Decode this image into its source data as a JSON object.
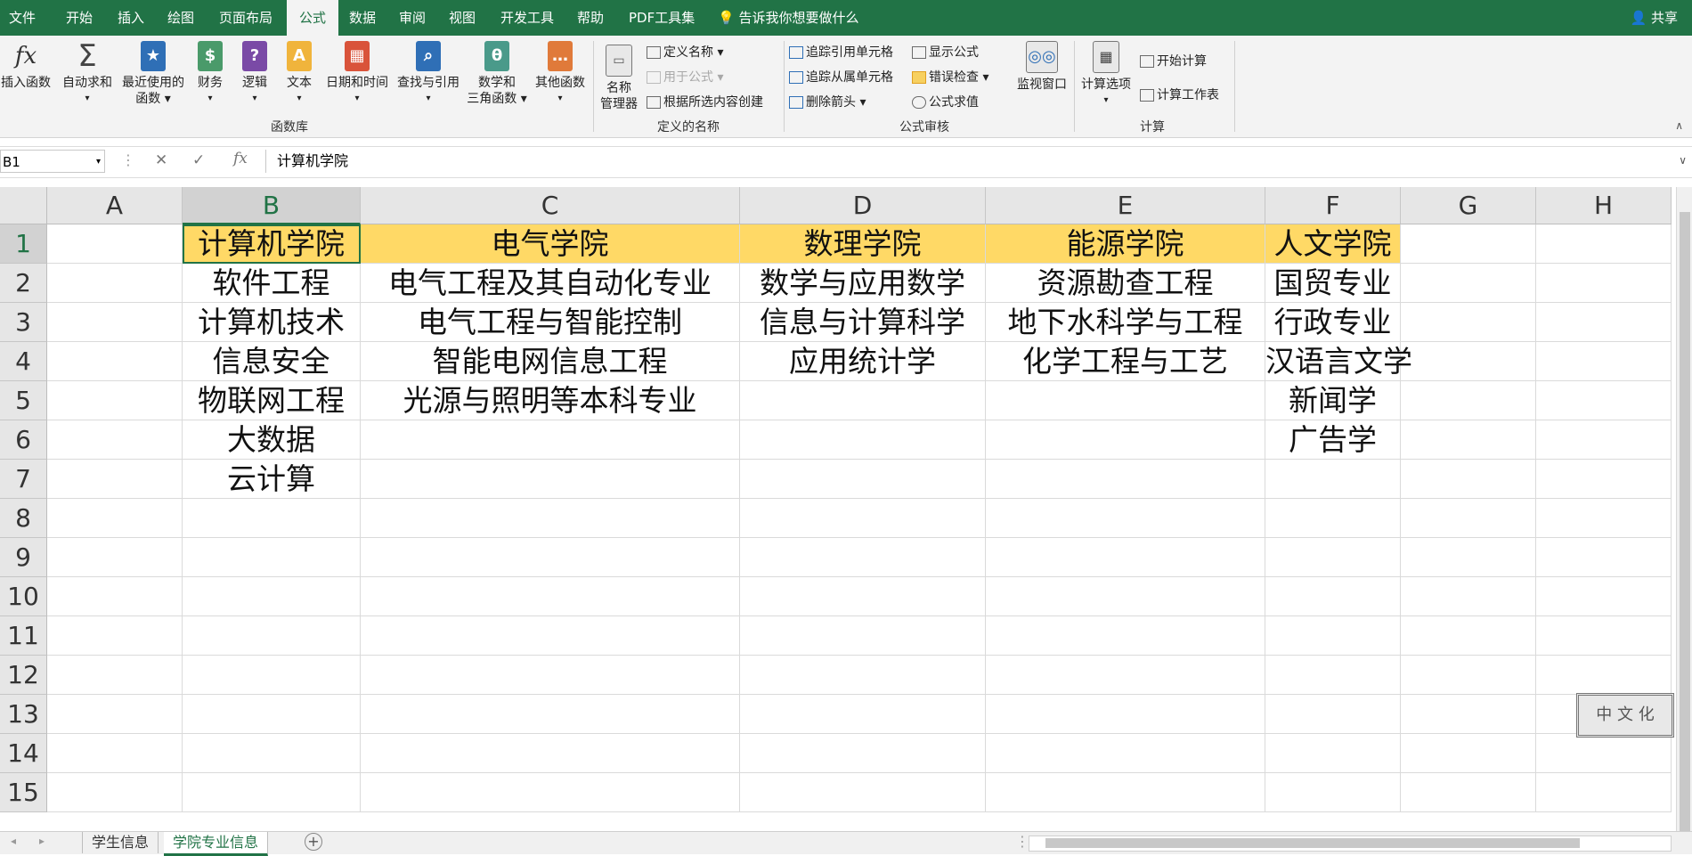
{
  "tabs": [
    "文件",
    "开始",
    "插入",
    "绘图",
    "页面布局",
    "公式",
    "数据",
    "审阅",
    "视图",
    "开发工具",
    "帮助",
    "PDF工具集"
  ],
  "active_tab": "公式",
  "tell_me": "告诉我你想要做什么",
  "share": "共享",
  "ribbon": {
    "function_library": {
      "label": "函数库",
      "insert_fn": "插入函数",
      "autosum": "自动求和",
      "recent": [
        "最近使用的",
        "函数"
      ],
      "finance": "财务",
      "logic": "逻辑",
      "text": "文本",
      "datetime": "日期和时间",
      "lookup": "查找与引用",
      "math": [
        "数学和",
        "三角函数"
      ],
      "other": "其他函数"
    },
    "defined_names": {
      "label": "定义的名称",
      "name_mgr": [
        "名称",
        "管理器"
      ],
      "define_name": "定义名称",
      "use_in_formula": "用于公式",
      "create_from_sel": "根据所选内容创建"
    },
    "auditing": {
      "label": "公式审核",
      "trace_precedents": "追踪引用单元格",
      "trace_dependents": "追踪从属单元格",
      "remove_arrows": "删除箭头",
      "show_formulas": "显示公式",
      "error_check": "错误检查",
      "evaluate": "公式求值",
      "watch": "监视窗口"
    },
    "calculation": {
      "label": "计算",
      "options": "计算选项",
      "calc_now": "开始计算",
      "calc_sheet": "计算工作表"
    }
  },
  "formula_bar": {
    "name_box": "B1",
    "content": "计算机学院"
  },
  "columns": [
    "A",
    "B",
    "C",
    "D",
    "E",
    "F",
    "G",
    "H"
  ],
  "rows": [
    "1",
    "2",
    "3",
    "4",
    "5",
    "6",
    "7",
    "8",
    "9",
    "10",
    "11",
    "12",
    "13",
    "14",
    "15"
  ],
  "cells": {
    "B": [
      "计算机学院",
      "软件工程",
      "计算机技术",
      "信息安全",
      "物联网工程",
      "大数据",
      "云计算"
    ],
    "C": [
      "电气学院",
      "电气工程及其自动化专业",
      "电气工程与智能控制",
      "智能电网信息工程",
      "光源与照明等本科专业"
    ],
    "D": [
      "数理学院",
      "数学与应用数学",
      "信息与计算科学",
      "应用统计学"
    ],
    "E": [
      "能源学院",
      "资源勘查工程",
      "地下水科学与工程",
      "化学工程与工艺"
    ],
    "F": [
      "人文学院",
      "国贸专业",
      "行政专业",
      "汉语言文学",
      "新闻学",
      "广告学"
    ]
  },
  "stamp_text": "中 文 化",
  "sheets": [
    "学生信息",
    "学院专业信息"
  ],
  "active_sheet": "学院专业信息",
  "colors": {
    "ribbon_green": "#217346",
    "header_fill": "#ffd966"
  }
}
